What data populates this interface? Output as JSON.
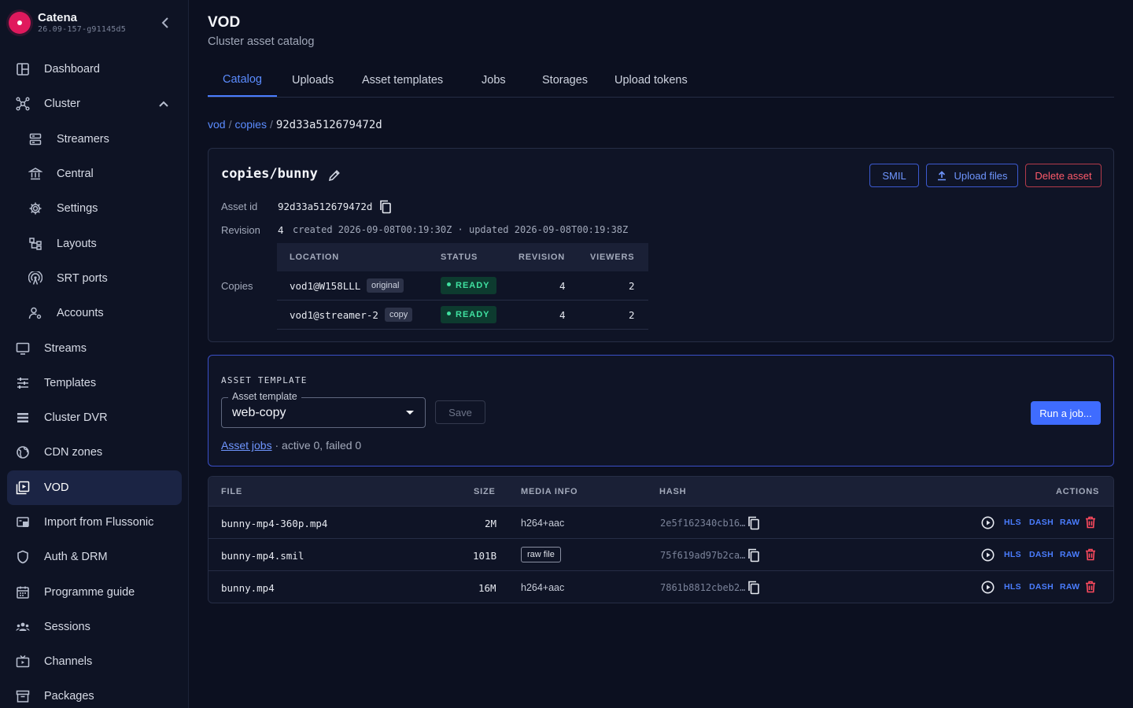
{
  "brand": {
    "name": "Catena",
    "version": "26.09-157-g91145d5"
  },
  "sidebar": {
    "items": [
      {
        "label": "Dashboard",
        "icon": "dashboard-icon"
      },
      {
        "label": "Cluster",
        "icon": "cluster-icon"
      },
      {
        "label": "Streamers",
        "icon": "server-icon"
      },
      {
        "label": "Central",
        "icon": "bank-icon"
      },
      {
        "label": "Settings",
        "icon": "gear-icon"
      },
      {
        "label": "Layouts",
        "icon": "layouts-icon"
      },
      {
        "label": "SRT ports",
        "icon": "antenna-icon"
      },
      {
        "label": "Accounts",
        "icon": "account-icon"
      },
      {
        "label": "Streams",
        "icon": "monitor-icon"
      },
      {
        "label": "Templates",
        "icon": "sliders-icon"
      },
      {
        "label": "Cluster DVR",
        "icon": "list-icon"
      },
      {
        "label": "CDN zones",
        "icon": "globe-icon"
      },
      {
        "label": "VOD",
        "icon": "vod-icon"
      },
      {
        "label": "Import from Flussonic",
        "icon": "import-icon"
      },
      {
        "label": "Auth & DRM",
        "icon": "shield-icon"
      },
      {
        "label": "Programme guide",
        "icon": "calendar-icon"
      },
      {
        "label": "Sessions",
        "icon": "users-icon"
      },
      {
        "label": "Channels",
        "icon": "tv-icon"
      },
      {
        "label": "Packages",
        "icon": "archive-icon"
      }
    ]
  },
  "header": {
    "title": "VOD",
    "subtitle": "Cluster asset catalog"
  },
  "tabs": [
    "Catalog",
    "Uploads",
    "Asset templates",
    "Jobs",
    "Storages",
    "Upload tokens"
  ],
  "breadcrumb": {
    "root": "vod",
    "sep": "/",
    "folder": "copies",
    "current": "92d33a512679472d"
  },
  "asset": {
    "name": "copies/bunny",
    "id_label": "Asset id",
    "id": "92d33a512679472d",
    "revision_label": "Revision",
    "revision": "4",
    "revision_info": "created 2026-09-08T00:19:30Z · updated 2026-09-08T00:19:38Z",
    "copies_label": "Copies",
    "buttons": {
      "smil": "SMIL",
      "upload": "Upload files",
      "delete": "Delete asset"
    },
    "copies_headers": [
      "LOCATION",
      "STATUS",
      "REVISION",
      "VIEWERS"
    ],
    "copies": [
      {
        "location": "vod1@W158LLL",
        "tag": "original",
        "status": "READY",
        "revision": "4",
        "viewers": "2"
      },
      {
        "location": "vod1@streamer-2",
        "tag": "copy",
        "status": "READY",
        "revision": "4",
        "viewers": "2"
      }
    ]
  },
  "template": {
    "section": "ASSET TEMPLATE",
    "field_label": "Asset template",
    "value": "web-copy",
    "save": "Save",
    "run": "Run a job...",
    "jobs_link": "Asset jobs",
    "jobs_info": "· active 0, failed 0"
  },
  "files": {
    "headers": [
      "FILE",
      "SIZE",
      "MEDIA INFO",
      "HASH",
      "ACTIONS"
    ],
    "actions": [
      "HLS",
      "DASH",
      "RAW"
    ],
    "rows": [
      {
        "file": "bunny-mp4-360p.mp4",
        "size": "2M",
        "media": "h264+aac",
        "raw": false,
        "hash": "2e5f162340cb16…"
      },
      {
        "file": "bunny-mp4.smil",
        "size": "101B",
        "media": "raw file",
        "raw": true,
        "hash": "75f619ad97b2ca…"
      },
      {
        "file": "bunny.mp4",
        "size": "16M",
        "media": "h264+aac",
        "raw": false,
        "hash": "7861b8812cbeb2…"
      }
    ]
  }
}
